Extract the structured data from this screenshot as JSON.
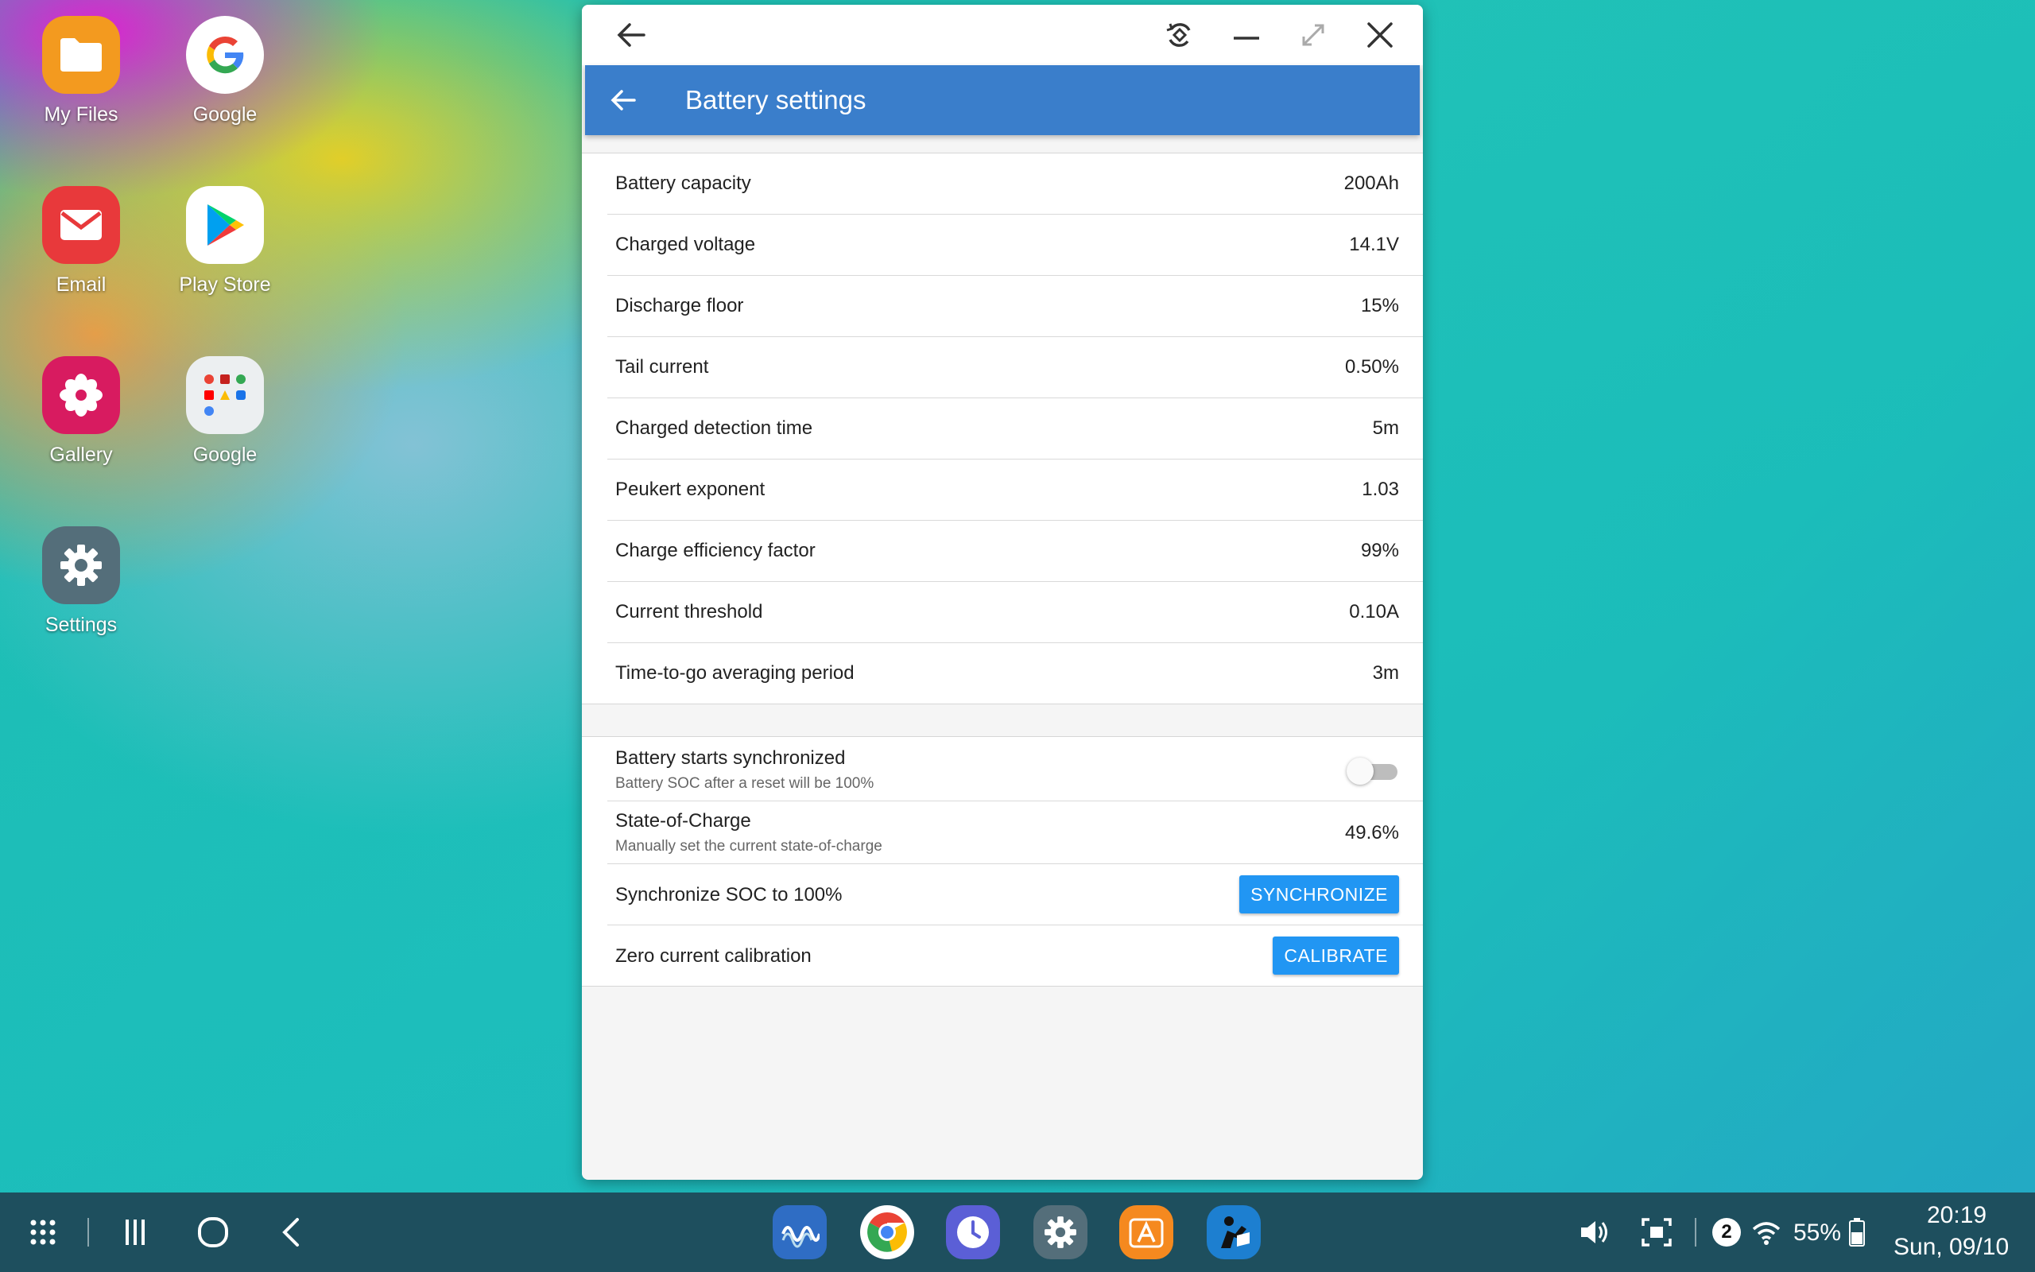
{
  "desktop": {
    "icons": [
      {
        "label": "My Files"
      },
      {
        "label": "Google"
      },
      {
        "label": "Email"
      },
      {
        "label": "Play Store"
      },
      {
        "label": "Gallery"
      },
      {
        "label": "Google"
      },
      {
        "label": "Settings"
      }
    ]
  },
  "window": {
    "titlebar": {
      "back_icon": "arrow-left-icon",
      "rotate_icon": "rotate-icon",
      "minimize_icon": "minimize-icon",
      "maximize_icon": "maximize-icon",
      "close_icon": "close-icon"
    },
    "appbar": {
      "title": "Battery settings",
      "color": "#3a7ecb"
    },
    "settings": [
      {
        "label": "Battery capacity",
        "value": "200Ah"
      },
      {
        "label": "Charged voltage",
        "value": "14.1V"
      },
      {
        "label": "Discharge floor",
        "value": "15%"
      },
      {
        "label": "Tail current",
        "value": "0.50%"
      },
      {
        "label": "Charged detection time",
        "value": "5m"
      },
      {
        "label": "Peukert exponent",
        "value": "1.03"
      },
      {
        "label": "Charge efficiency factor",
        "value": "99%"
      },
      {
        "label": "Current threshold",
        "value": "0.10A"
      },
      {
        "label": "Time-to-go averaging period",
        "value": "3m"
      }
    ],
    "sync": {
      "label": "Battery starts synchronized",
      "sub": "Battery SOC after a reset will be 100%",
      "on": false
    },
    "soc": {
      "label": "State-of-Charge",
      "sub": "Manually set the current state-of-charge",
      "value": "49.6%"
    },
    "sync_soc": {
      "label": "Synchronize SOC to 100%",
      "button": "SYNCHRONIZE"
    },
    "zero_cal": {
      "label": "Zero current calibration",
      "button": "CALIBRATE"
    },
    "button_color": "#2196f3"
  },
  "taskbar": {
    "nav_icons": [
      "apps-grid-icon",
      "recents-icon",
      "home-icon",
      "back-icon"
    ],
    "dock_apps": [
      "victron-connect-icon",
      "chrome-icon",
      "clock-icon",
      "settings-icon",
      "store-icon",
      "kindle-icon"
    ],
    "notification_count": "2",
    "battery_percent": "55%",
    "time": "20:19",
    "date": "Sun, 09/10"
  }
}
